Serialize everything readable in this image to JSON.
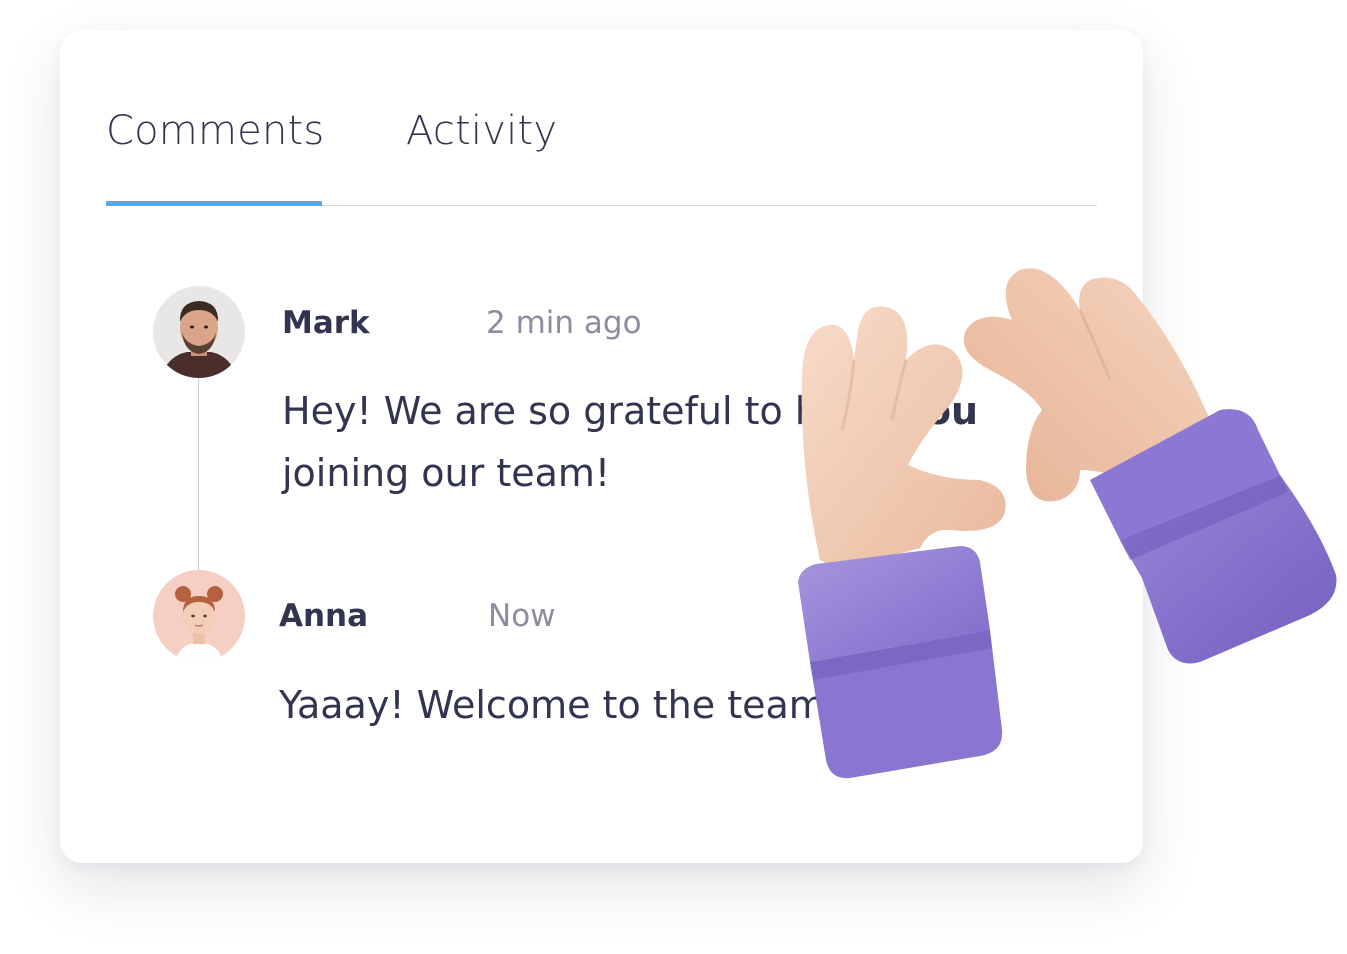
{
  "tabs": [
    {
      "label": "Comments",
      "active": true
    },
    {
      "label": "Activity",
      "active": false
    }
  ],
  "comments": [
    {
      "author": "Mark",
      "time": "2 min ago",
      "text_before": "Hey! We are so grateful to have ",
      "text_bold": "you",
      "text_line2": "joining our team!"
    },
    {
      "author": "Anna",
      "time": "Now",
      "text": "Yaaay! Welcome to the team"
    }
  ],
  "colors": {
    "accent": "#5aa8e6",
    "text": "#323450",
    "muted": "#8c8ea0",
    "sleeve": "#8f7dd8",
    "skin": "#f2c8ad"
  },
  "decor": {
    "illustration": "heart-hands-icon"
  }
}
